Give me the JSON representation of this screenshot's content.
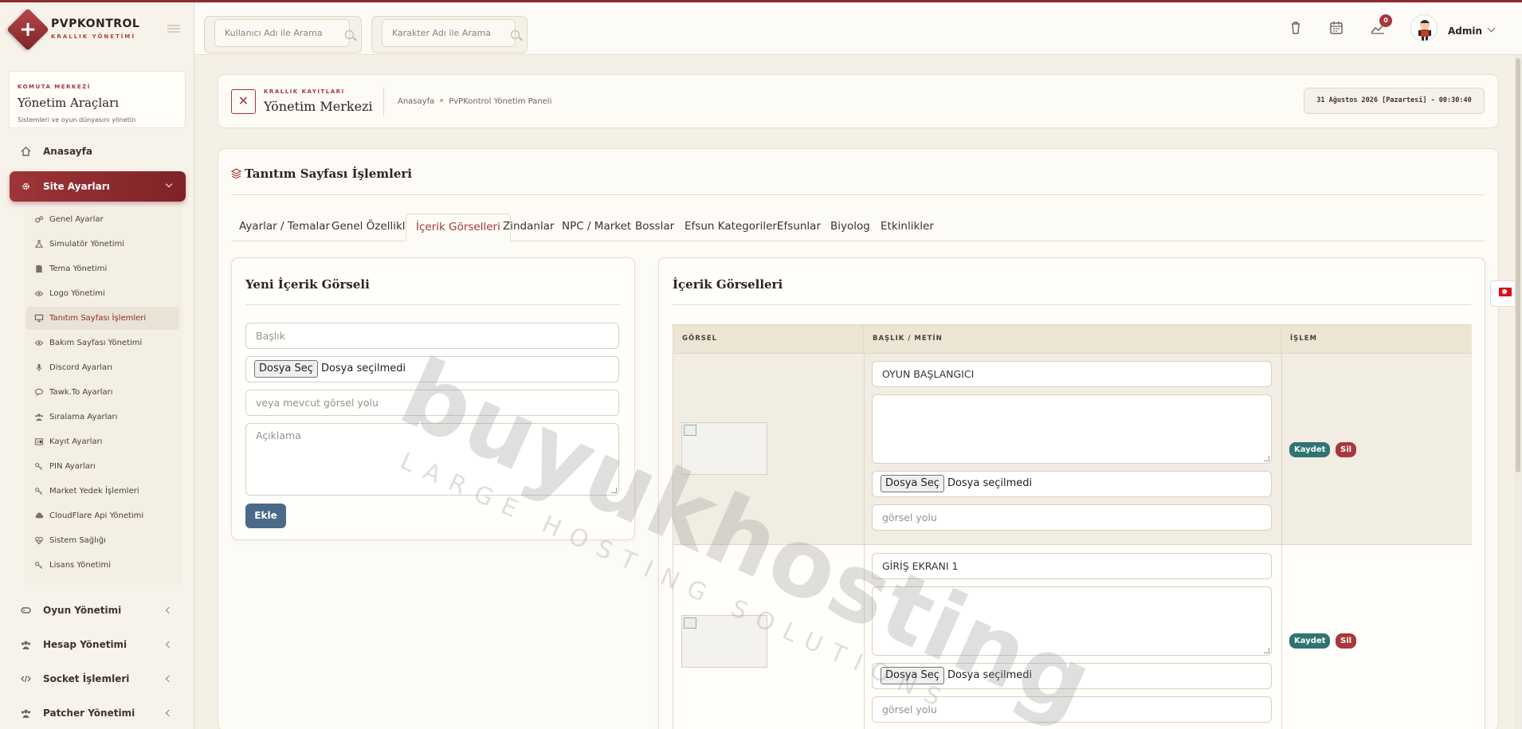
{
  "brand": {
    "title": "PVPKONTROL",
    "subtitle": "KRALLIK YÖNETİMİ"
  },
  "search": {
    "user_placeholder": "Kullanıcı Adı ile Arama",
    "char_placeholder": "Karakter Adı ile Arama"
  },
  "topbar": {
    "notification_count": "0",
    "admin_label": "Admin",
    "icons": [
      "trash-icon",
      "calendar-icon",
      "chart-icon"
    ]
  },
  "sidebar": {
    "card": {
      "kicker": "KOMUTA MERKEZİ",
      "title": "Yönetim Araçları",
      "subtitle": "Sistemleri ve oyun dünyasını yönetin"
    },
    "items": [
      {
        "label": "Anasayfa",
        "icon": "home-icon"
      },
      {
        "label": "Site Ayarları",
        "icon": "gear-icon",
        "active": true
      },
      {
        "label": "Oyun Yönetimi",
        "icon": "gamepad-icon"
      },
      {
        "label": "Hesap Yönetimi",
        "icon": "users-icon"
      },
      {
        "label": "Socket İşlemleri",
        "icon": "code-icon"
      },
      {
        "label": "Patcher Yönetimi",
        "icon": "users-icon"
      }
    ],
    "submenu": [
      {
        "label": "Genel Ayarlar",
        "icon": "cogs-icon"
      },
      {
        "label": "Simulatör Yönetimi",
        "icon": "flask-icon"
      },
      {
        "label": "Tema Yönetimi",
        "icon": "file-icon"
      },
      {
        "label": "Logo Yönetimi",
        "icon": "eye-icon"
      },
      {
        "label": "Tanıtım Sayfası İşlemleri",
        "icon": "desktop-icon",
        "active": true
      },
      {
        "label": "Bakım Sayfası Yönetimi",
        "icon": "eye-icon"
      },
      {
        "label": "Discord Ayarları",
        "icon": "mic-icon"
      },
      {
        "label": "Tawk.To Ayarları",
        "icon": "chat-icon"
      },
      {
        "label": "Sıralama Ayarları",
        "icon": "users-icon"
      },
      {
        "label": "Kayıt Ayarları",
        "icon": "card-icon"
      },
      {
        "label": "PIN Ayarları",
        "icon": "key-icon"
      },
      {
        "label": "Market Yedek İşlemleri",
        "icon": "key-icon"
      },
      {
        "label": "CloudFlare Api Yönetimi",
        "icon": "cloud-icon"
      },
      {
        "label": "Sistem Sağlığı",
        "icon": "heart-icon"
      },
      {
        "label": "Lisans Yönetimi",
        "icon": "key-icon"
      }
    ]
  },
  "header": {
    "kicker": "KRALLIK KAYITLARI",
    "title": "Yönetim Merkezi",
    "breadcrumb": [
      "Anasayfa",
      "PvPKontrol Yönetim Paneli"
    ],
    "datetime": "31 Ağustos 2026 [Pazartesi] - 00:30:40"
  },
  "main": {
    "section_title": "Tanıtım Sayfası İşlemleri",
    "tabs": [
      "Ayarlar / Temalar",
      "Genel Özellikler",
      "İçerik Görselleri",
      "Zindanlar",
      "NPC / Market",
      "Bosslar",
      "Efsun Kategorileri",
      "Efsunlar",
      "Biyolog",
      "Etkinlikler"
    ],
    "active_tab": 2
  },
  "form": {
    "title": "Yeni İçerik Görseli",
    "title_placeholder": "Başlık",
    "file_button": "Dosya Seç",
    "file_status": "Dosya seçilmedi",
    "path_placeholder": "veya mevcut görsel yolu",
    "desc_placeholder": "Açıklama",
    "submit": "Ekle"
  },
  "list": {
    "title": "İçerik Görselleri",
    "columns": [
      "GÖRSEL",
      "BAŞLIK / METİN",
      "İŞLEM"
    ],
    "rows": [
      {
        "title": "OYUN BAŞLANGICI",
        "file_button": "Dosya Seç",
        "file_status": "Dosya seçilmedi",
        "path_placeholder": "görsel yolu",
        "save": "Kaydet",
        "delete": "Sil"
      },
      {
        "title": "GİRİŞ EKRANI 1",
        "file_button": "Dosya Seç",
        "file_status": "Dosya seçilmedi",
        "path_placeholder": "görsel yolu",
        "save": "Kaydet",
        "delete": "Sil"
      }
    ]
  },
  "watermark": {
    "line1": "buyukhosting",
    "line2": "LARGE HOSTING SOLUTIONS"
  }
}
